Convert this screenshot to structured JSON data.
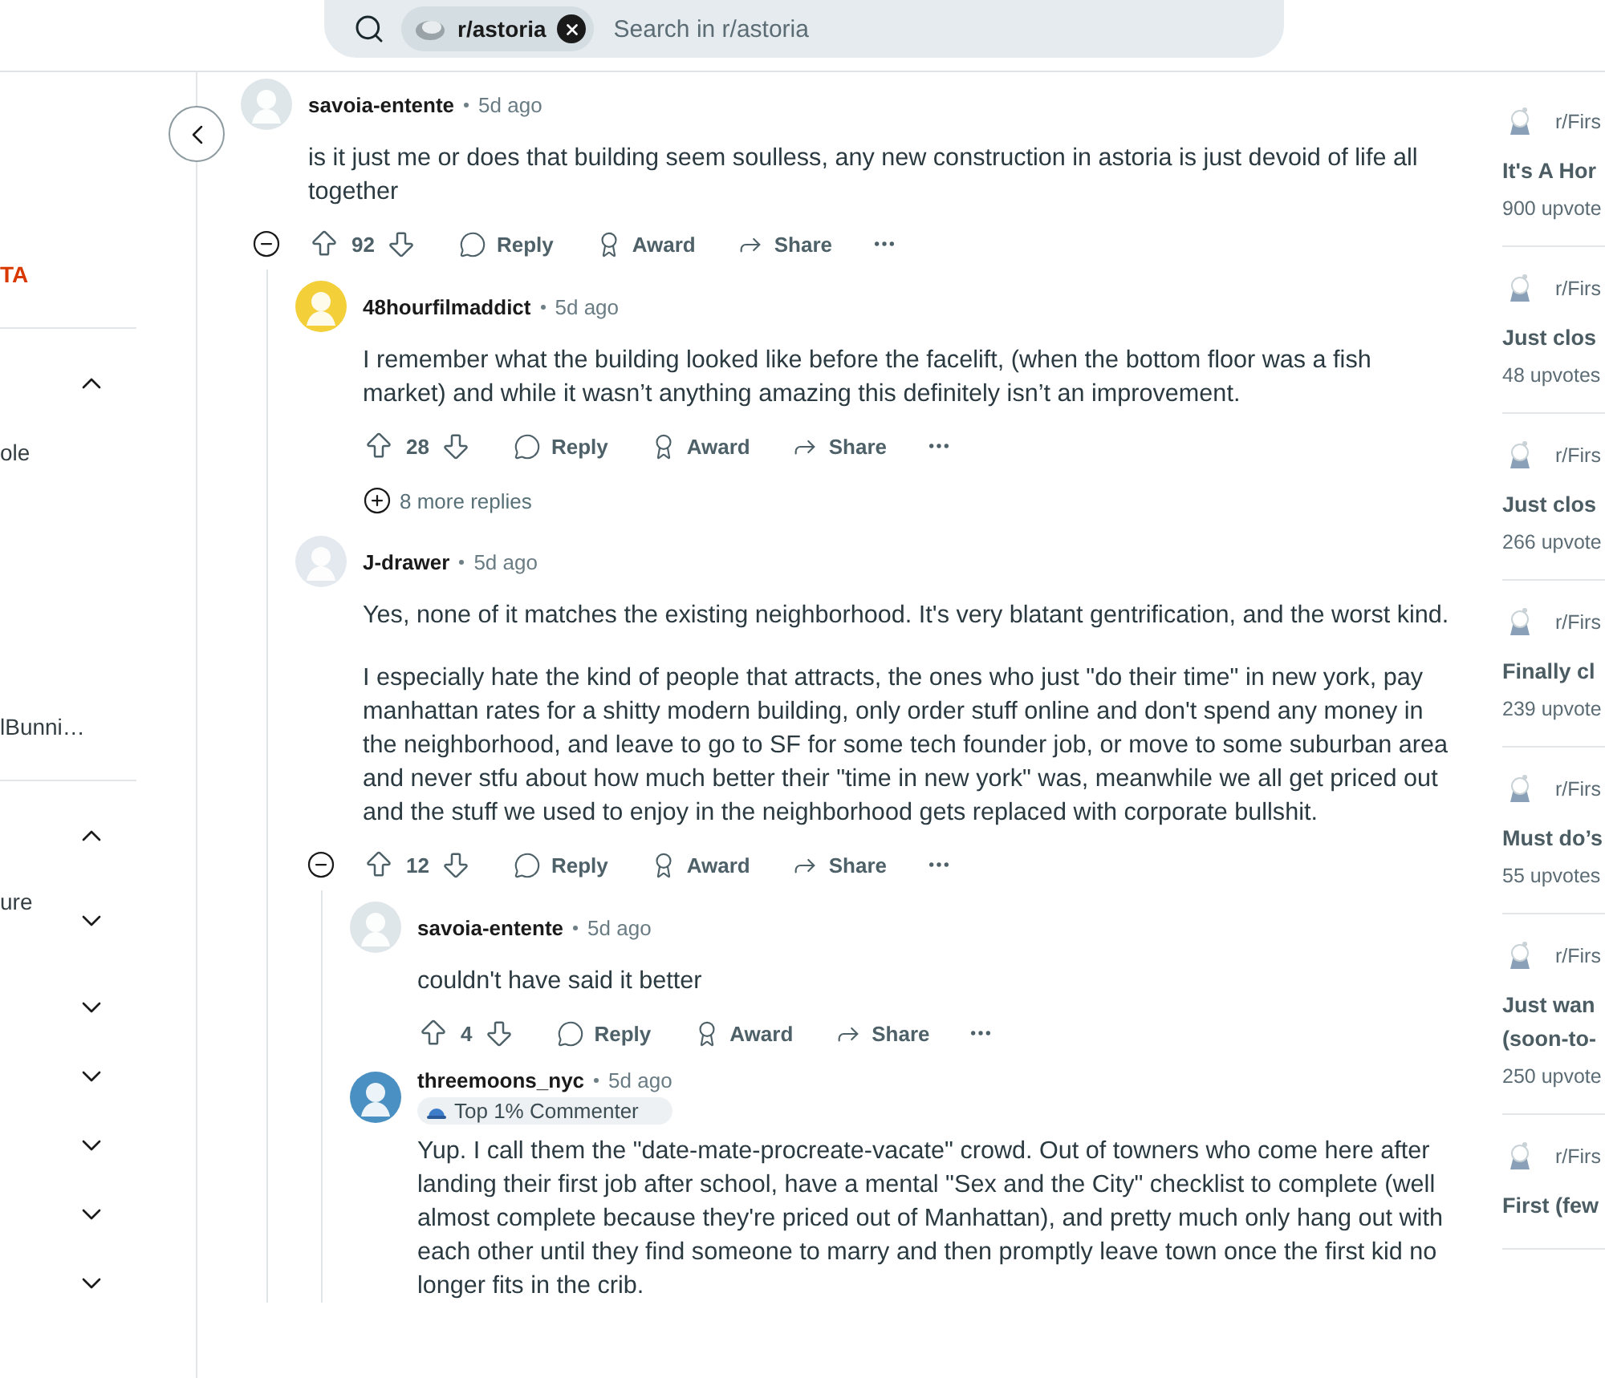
{
  "search": {
    "community": "r/astoria",
    "placeholder": "Search in r/astoria"
  },
  "sidebar": {
    "rows": [
      {
        "kind": "accent",
        "label": "TA"
      },
      {
        "kind": "divider"
      },
      {
        "kind": "toggle",
        "expanded": true
      },
      {
        "kind": "label",
        "label": "ole"
      },
      {
        "kind": "label",
        "label": "lBunni…"
      },
      {
        "kind": "divider"
      },
      {
        "kind": "toggle",
        "expanded": true
      },
      {
        "kind": "toggle",
        "label": "ure",
        "expanded": false
      },
      {
        "kind": "toggle",
        "expanded": false
      },
      {
        "kind": "toggle",
        "expanded": false
      },
      {
        "kind": "toggle",
        "expanded": false
      },
      {
        "kind": "toggle",
        "expanded": false
      },
      {
        "kind": "toggle",
        "expanded": false
      }
    ]
  },
  "comments": [
    {
      "author": "savoia-entente",
      "age": "5d ago",
      "color": "#dfe6ea",
      "paragraphs": [
        "is it just me or does that building seem soulless, any new construction in astoria is just devoid of life all together"
      ],
      "votes": "92",
      "actions": [
        "Reply",
        "Award",
        "Share"
      ],
      "expanded": true,
      "children": [
        {
          "author": "48hourfilmaddict",
          "age": "5d ago",
          "color": "#f3cf3a",
          "paragraphs": [
            "I remember what the building looked like before the facelift, (when the bottom floor was a fish market) and while it wasn’t anything amazing this definitely isn’t an improvement."
          ],
          "votes": "28",
          "actions": [
            "Reply",
            "Award",
            "Share"
          ],
          "expanded": false,
          "more_replies": "8 more replies"
        },
        {
          "author": "J-drawer",
          "age": "5d ago",
          "color": "#e3e9ee",
          "paragraphs": [
            "Yes, none of it matches the existing neighborhood. It's very blatant gentrification, and the worst kind.",
            "I especially hate the kind of people that attracts, the ones who just \"do their time\" in new york, pay manhattan rates for a shitty modern building, only order stuff online and don't spend any money in the neighborhood, and leave to go to SF for some tech founder job, or move to some suburban area and never stfu about how much better their \"time in new york\" was, meanwhile we all get priced out and the stuff we used to enjoy in the neighborhood gets replaced with corporate bullshit."
          ],
          "votes": "12",
          "actions": [
            "Reply",
            "Award",
            "Share"
          ],
          "expanded": true,
          "children": [
            {
              "author": "savoia-entente",
              "age": "5d ago",
              "color": "#dfe6ea",
              "paragraphs": [
                "couldn't have said it better"
              ],
              "votes": "4",
              "actions": [
                "Reply",
                "Award",
                "Share"
              ],
              "expanded": false
            },
            {
              "author": "threemoons_nyc",
              "age": "5d ago",
              "color": "#4a90c2",
              "badge": "Top 1% Commenter",
              "paragraphs": [
                "Yup. I call them the \"date-mate-procreate-vacate\" crowd. Out of towners who come here after landing their first job after school, have a mental \"Sex and the City\" checklist to complete (well almost complete because they're priced out of Manhattan), and pretty much only hang out with each other until they find someone to marry and then promptly leave town once the first kid no longer fits in the crib."
              ],
              "expanded": false
            }
          ]
        }
      ]
    }
  ],
  "related": [
    {
      "community": "r/Firs",
      "title_lines": [
        "It's A Hor"
      ],
      "upvotes": "900 upvote"
    },
    {
      "community": "r/Firs",
      "title_lines": [
        "Just clos"
      ],
      "upvotes": "48 upvotes"
    },
    {
      "community": "r/Firs",
      "title_lines": [
        "Just clos"
      ],
      "upvotes": "266 upvote"
    },
    {
      "community": "r/Firs",
      "title_lines": [
        "Finally cl"
      ],
      "upvotes": "239 upvote"
    },
    {
      "community": "r/Firs",
      "title_lines": [
        "Must do’s"
      ],
      "upvotes": "55 upvotes"
    },
    {
      "community": "r/Firs",
      "title_lines": [
        "Just wan",
        "(soon-to-"
      ],
      "upvotes": "250 upvote"
    },
    {
      "community": "r/Firs",
      "title_lines": [
        "First (few"
      ]
    }
  ]
}
